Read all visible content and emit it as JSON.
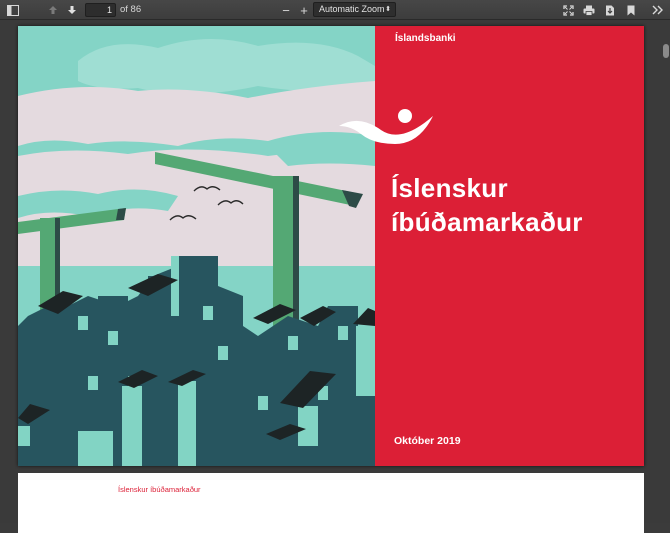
{
  "toolbar": {
    "page_number": "1",
    "page_count_label": "of 86",
    "zoom_label": "Automatic Zoom",
    "zoom_options": [
      "Automatic Zoom"
    ],
    "zoom_out_symbol": "−",
    "zoom_in_symbol": "+",
    "icons": [
      "sidebar-toggle-icon",
      "previous-page-icon",
      "next-page-icon",
      "presentation-mode-icon",
      "print-icon",
      "download-icon",
      "bookmark-icon",
      "tools-icon"
    ]
  },
  "cover": {
    "brand": "Íslandsbanki",
    "title_line1": "Íslenskur",
    "title_line2": "íbúðamarkaður",
    "date": "Október 2019",
    "colors": {
      "red": "#dc1f36",
      "sky": "#84d4c6",
      "buildings": "#27555f",
      "crane": "#54a874"
    }
  },
  "page2": {
    "header": "Íslenskur íbúðamarkaður"
  }
}
